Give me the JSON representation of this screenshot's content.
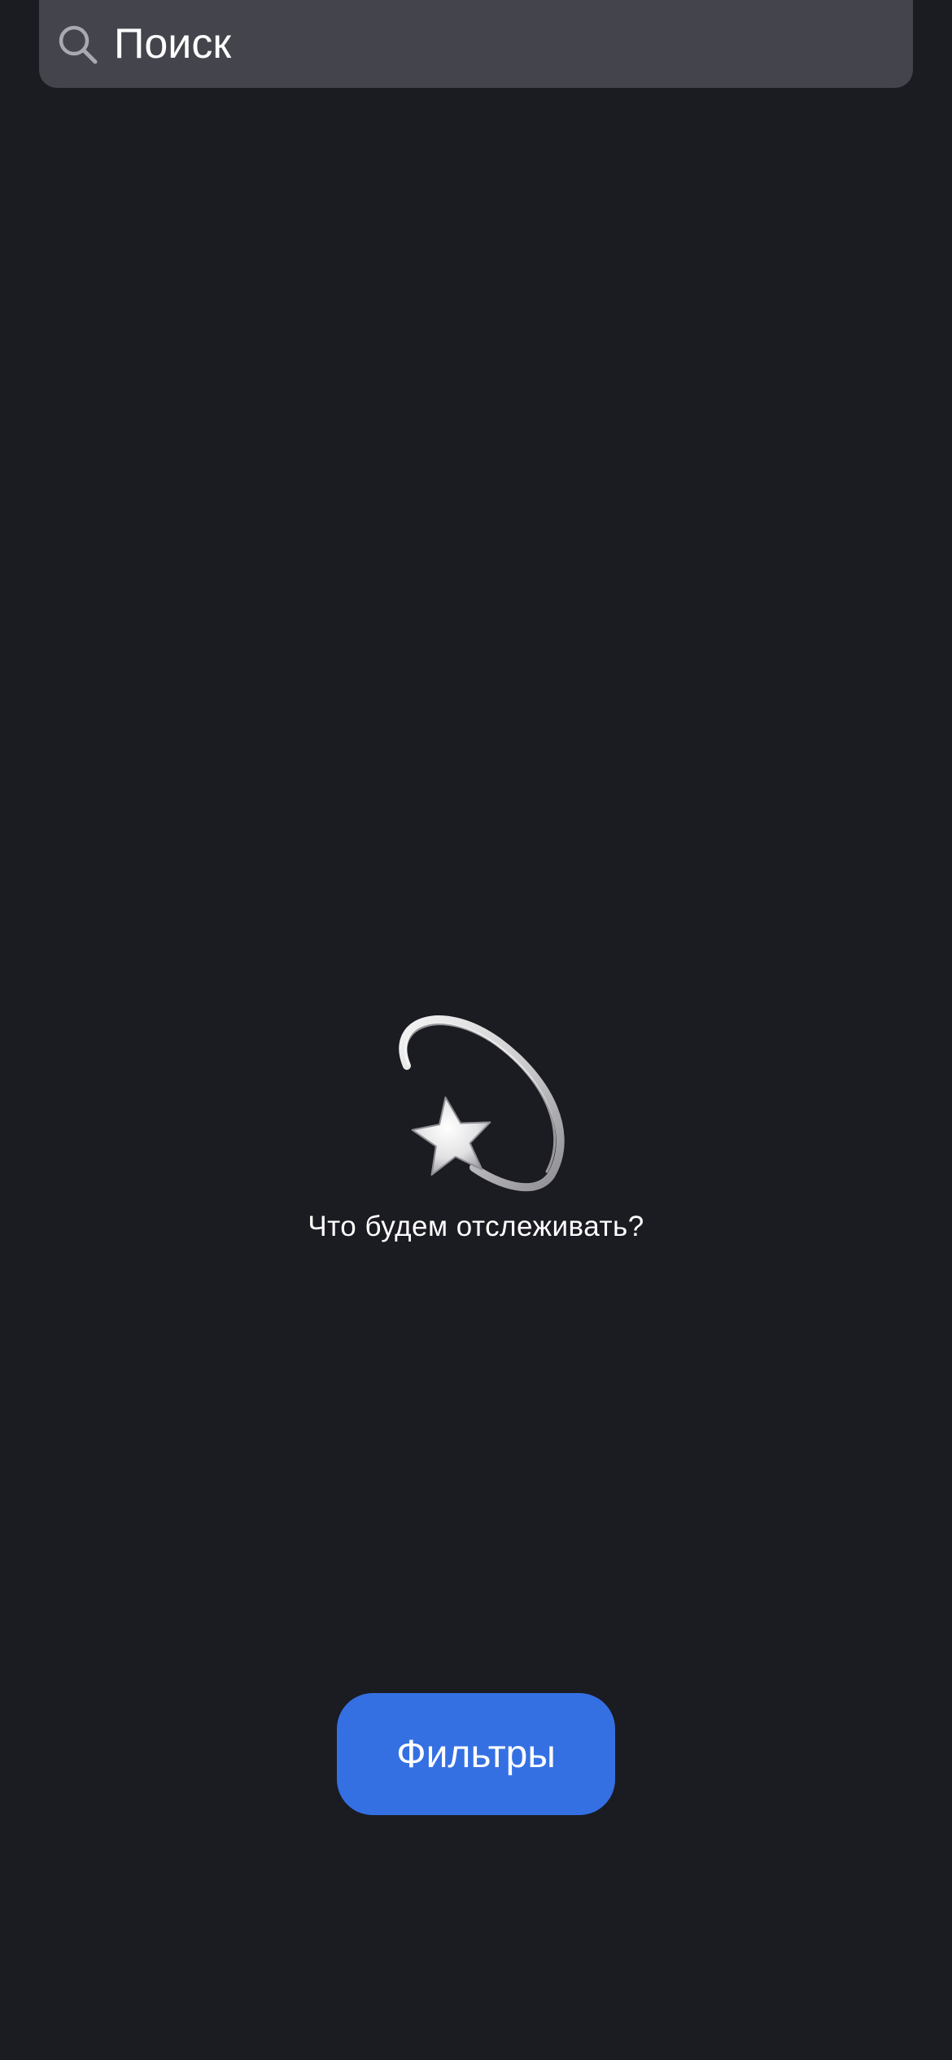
{
  "search": {
    "placeholder": "Поиск",
    "icon": "search-icon"
  },
  "empty_state": {
    "icon": "dizzy-star-icon",
    "title": "Что будем отслеживать?"
  },
  "actions": {
    "filters_label": "Фильтры"
  },
  "colors": {
    "background": "#1b1b22",
    "search_bg": "#44444d",
    "accent": "#3570e3",
    "text": "#ffffff"
  }
}
